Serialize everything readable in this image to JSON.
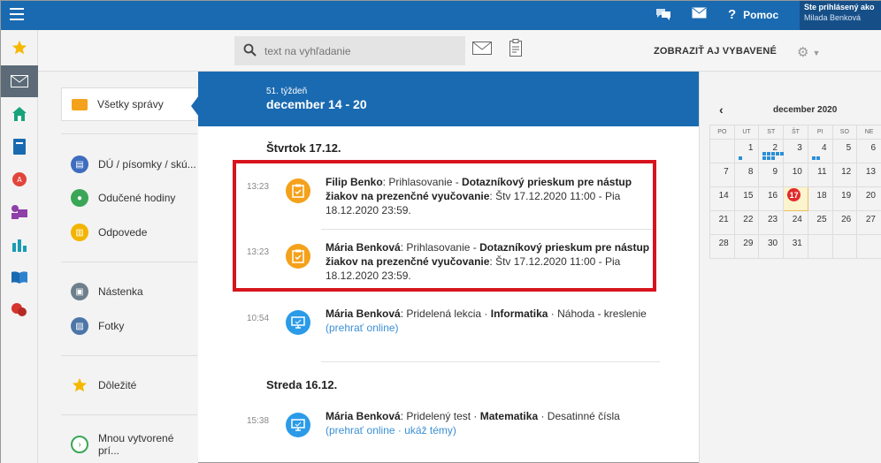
{
  "topbar": {
    "help_label": "Pomoc",
    "login_line1": "Ste prihlásený ako",
    "login_line2": "Milada Benková",
    "icons": [
      "menu-icon",
      "chat-icon",
      "mail-icon",
      "help-icon"
    ]
  },
  "toolbar": {
    "search_placeholder": "text na vyhľadanie",
    "show_done_label": "ZOBRAZIŤ AJ VYBAVENÉ"
  },
  "nav": {
    "items": [
      {
        "label": "Všetky správy",
        "icon": "mail-icon",
        "color": "#f4a11b"
      },
      {
        "label": "DÚ / písomky / skú...",
        "icon": "homework-icon",
        "color": "#3e6dbf"
      },
      {
        "label": "Odučené hodiny",
        "icon": "person-icon",
        "color": "#3aa657"
      },
      {
        "label": "Odpovede",
        "icon": "answers-icon",
        "color": "#f3b400"
      },
      {
        "label": "Nástenka",
        "icon": "board-icon",
        "color": "#6d7f8c"
      },
      {
        "label": "Fotky",
        "icon": "photo-icon",
        "color": "#4d76a8"
      },
      {
        "label": "Dôležité",
        "icon": "star-icon",
        "color": "#f5b800"
      },
      {
        "label": "Mnou vytvorené prí...",
        "icon": "created-icon",
        "color": "#3aa657"
      }
    ]
  },
  "week": {
    "label": "51. týždeň",
    "range": "december 14 - 20"
  },
  "days": [
    {
      "title": "Štvrtok 17.12."
    },
    {
      "title": "Streda 16.12."
    }
  ],
  "messages": [
    {
      "time": "13:23",
      "sender": "Filip Benko",
      "action": ": Prihlasovanie - ",
      "subject": "Dotazníkový prieskum pre nástup žiakov na prezenčné vyučovanie",
      "rest": ": Štv 17.12.2020 11:00 - Pia 18.12.2020 23:59."
    },
    {
      "time": "13:23",
      "sender": "Mária Benková",
      "action": ": Prihlasovanie - ",
      "subject": "Dotazníkový prieskum pre nástup žiakov na prezenčné vyučovanie",
      "rest": ": Štv 17.12.2020 11:00 - Pia 18.12.2020 23:59."
    },
    {
      "time": "10:54",
      "sender": "Mária Benková",
      "action": ": Pridelená lekcia · ",
      "subject": "Informatika",
      "rest": " · Náhoda - kreslenie",
      "link1": "(prehrať online)"
    },
    {
      "time": "15:38",
      "sender": "Mária Benková",
      "action": ": Pridelený test · ",
      "subject": "Matematika",
      "rest": " · Desatinné čísla",
      "link1": "(prehrať online",
      "link_sep": " · ",
      "link2": "ukáž témy)"
    }
  ],
  "calendar": {
    "month": "december 2020",
    "weekdays": [
      "PO",
      "UT",
      "ST",
      "ŠT",
      "PI",
      "SO",
      "NE"
    ],
    "weeks": [
      [
        "",
        "1",
        "2",
        "3",
        "4",
        "5",
        "6"
      ],
      [
        "7",
        "8",
        "9",
        "10",
        "11",
        "12",
        "13"
      ],
      [
        "14",
        "15",
        "16",
        "17",
        "18",
        "19",
        "20"
      ],
      [
        "21",
        "22",
        "23",
        "24",
        "25",
        "26",
        "27"
      ],
      [
        "28",
        "29",
        "30",
        "31",
        "",
        "",
        ""
      ]
    ],
    "today": "17"
  }
}
